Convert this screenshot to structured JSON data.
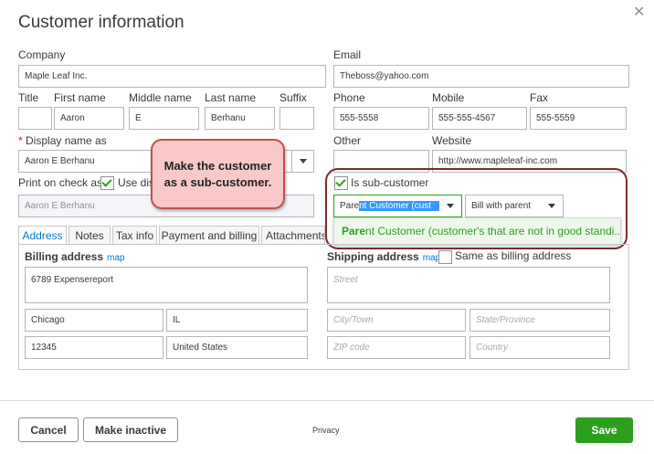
{
  "dialog": {
    "title": "Customer information",
    "close_glyph": "✕"
  },
  "fields": {
    "company_label": "Company",
    "company_value": "Maple Leaf Inc.",
    "email_label": "Email",
    "email_value": "Theboss@yahoo.com",
    "title_label": "Title",
    "title_value": "",
    "first_name_label": "First name",
    "first_name_value": "Aaron",
    "middle_name_label": "Middle name",
    "middle_name_value": "E",
    "last_name_label": "Last name",
    "last_name_value": "Berhanu",
    "suffix_label": "Suffix",
    "suffix_value": "",
    "phone_label": "Phone",
    "phone_value": "555-5558",
    "mobile_label": "Mobile",
    "mobile_value": "555-555-4567",
    "fax_label": "Fax",
    "fax_value": "555-5559",
    "display_name_required": "*",
    "display_name_label": "Display name as",
    "display_name_value": "Aaron E Berhanu",
    "other_label": "Other",
    "other_value": "",
    "website_label": "Website",
    "website_value": "http://www.mapleleaf-inc.com",
    "print_check_label": "Print on check as",
    "use_display_label": "Use dis",
    "print_check_value": "Aaron E Berhanu"
  },
  "subcustomer": {
    "checkbox_label": "Is sub-customer",
    "parent_pre": "Pare",
    "parent_selected": "nt Customer (cust",
    "bill_with": "Bill with parent",
    "option_match": "Pare",
    "option_rest": "nt Customer (customer's that are not in good standi..."
  },
  "callout": {
    "text": "Make the customer as a sub-customer."
  },
  "tabs": [
    "Address",
    "Notes",
    "Tax info",
    "Payment and billing",
    "Attachments"
  ],
  "billing": {
    "label": "Billing address",
    "map": "map",
    "street": "6789 Expensereport",
    "city": "Chicago",
    "state": "IL",
    "zip": "12345",
    "country": "United States"
  },
  "shipping": {
    "label": "Shipping address",
    "map": "map",
    "same_label": "Same as billing address",
    "street_ph": "Street",
    "city_ph": "City/Town",
    "state_ph": "State/Province",
    "zip_ph": "ZIP code",
    "country_ph": "Country"
  },
  "footer": {
    "cancel": "Cancel",
    "make_inactive": "Make inactive",
    "privacy": "Privacy",
    "save": "Save"
  },
  "colors": {
    "save_green": "#2ca01c",
    "callout_border": "#c0504d",
    "highlight_border": "#7b2c2c",
    "selection_blue": "#3399ff",
    "link_blue": "#0077c5"
  }
}
